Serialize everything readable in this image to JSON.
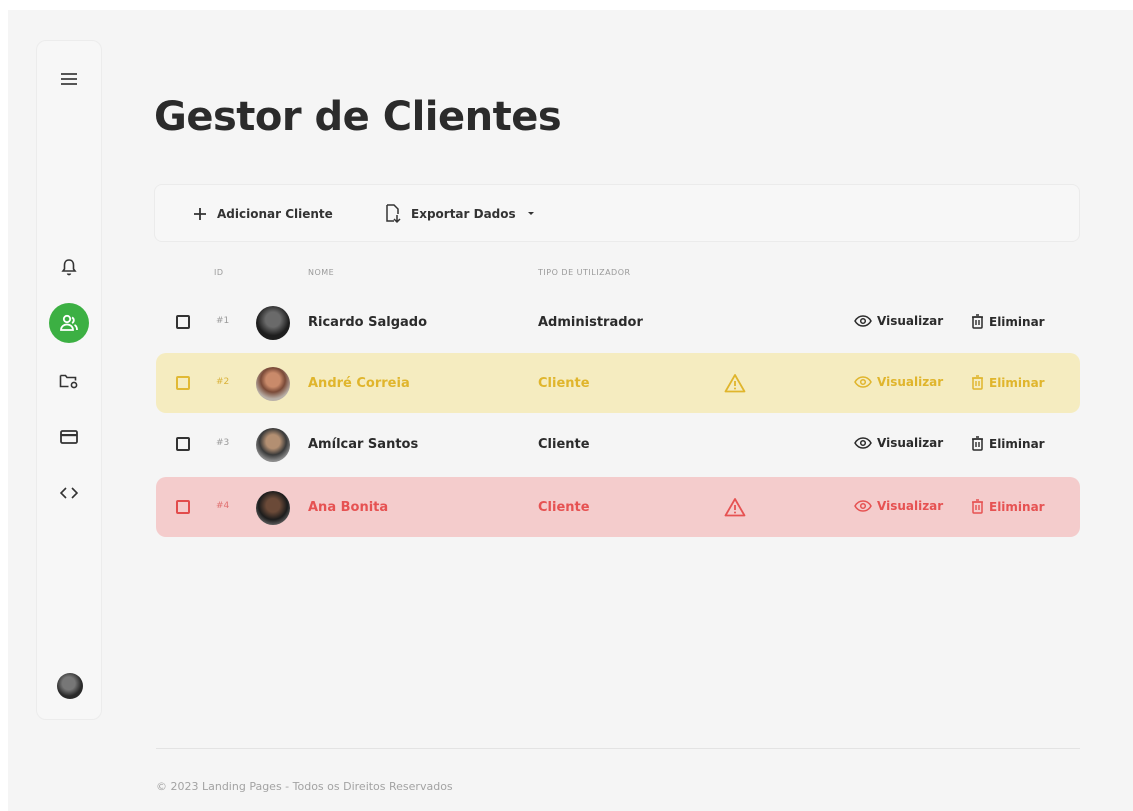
{
  "page": {
    "title": "Gestor de Clientes"
  },
  "toolbar": {
    "add_label": "Adicionar Cliente",
    "export_label": "Exportar Dados"
  },
  "table": {
    "headers": [
      "ID",
      "NOME",
      "TIPO DE UTILIZADOR"
    ],
    "view_label": "Visualizar",
    "delete_label": "Eliminar",
    "rows": [
      {
        "id": "#1",
        "name": "Ricardo Salgado",
        "type": "Administrador",
        "status": "normal"
      },
      {
        "id": "#2",
        "name": "André Correia",
        "type": "Cliente",
        "status": "warning"
      },
      {
        "id": "#3",
        "name": "Amílcar Santos",
        "type": "Cliente",
        "status": "normal"
      },
      {
        "id": "#4",
        "name": "Ana Bonita",
        "type": "Cliente",
        "status": "danger"
      }
    ]
  },
  "footer": {
    "text": "© 2023 Landing Pages - Todos os Direitos Reservados"
  },
  "sidebar": {
    "icons": [
      "menu-icon",
      "bell-icon",
      "users-icon",
      "folder-settings-icon",
      "card-icon",
      "code-icon"
    ],
    "active": "users-icon"
  },
  "colors": {
    "accent": "#3cb043",
    "warning_bg": "#f5ecc0",
    "warning_text": "#e0b52c",
    "danger_bg": "#f4cccc",
    "danger_text": "#e65252"
  }
}
